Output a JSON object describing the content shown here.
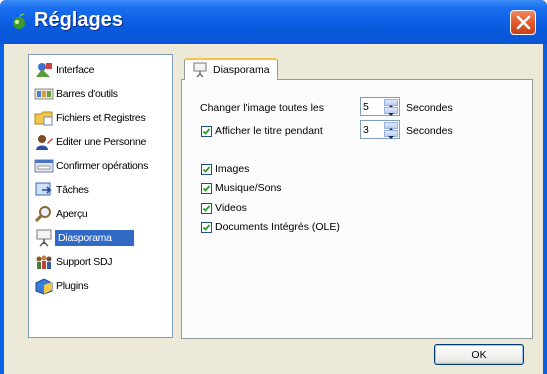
{
  "window": {
    "title": "Réglages",
    "close_icon": "close-icon"
  },
  "sidebar": {
    "selected_index": 7,
    "items": [
      {
        "label": "Interface",
        "icon": "interface-icon"
      },
      {
        "label": "Barres d'outils",
        "icon": "toolbar-icon"
      },
      {
        "label": "Fichiers et Registres",
        "icon": "folder-icon"
      },
      {
        "label": "Editer une Personne",
        "icon": "person-edit-icon"
      },
      {
        "label": "Confirmer opérations",
        "icon": "confirm-icon"
      },
      {
        "label": "Tâches",
        "icon": "tasks-icon"
      },
      {
        "label": "Aperçu",
        "icon": "preview-icon"
      },
      {
        "label": "Diasporama",
        "icon": "slideshow-icon"
      },
      {
        "label": "Support SDJ",
        "icon": "support-icon"
      },
      {
        "label": "Plugins",
        "icon": "plugins-icon"
      }
    ]
  },
  "tab": {
    "label": "Diasporama",
    "icon": "slideshow-icon"
  },
  "settings": {
    "interval": {
      "label": "Changer l'image toutes les",
      "value": "5",
      "unit": "Secondes"
    },
    "title_display": {
      "label": "Afficher le titre pendant",
      "checked": true,
      "value": "3",
      "unit": "Secondes"
    },
    "media": [
      {
        "label": "Images",
        "checked": true
      },
      {
        "label": "Musique/Sons",
        "checked": true
      },
      {
        "label": "Videos",
        "checked": true
      },
      {
        "label": "Documents Intégrés (OLE)",
        "checked": true
      }
    ]
  },
  "buttons": {
    "ok_label": "OK"
  }
}
